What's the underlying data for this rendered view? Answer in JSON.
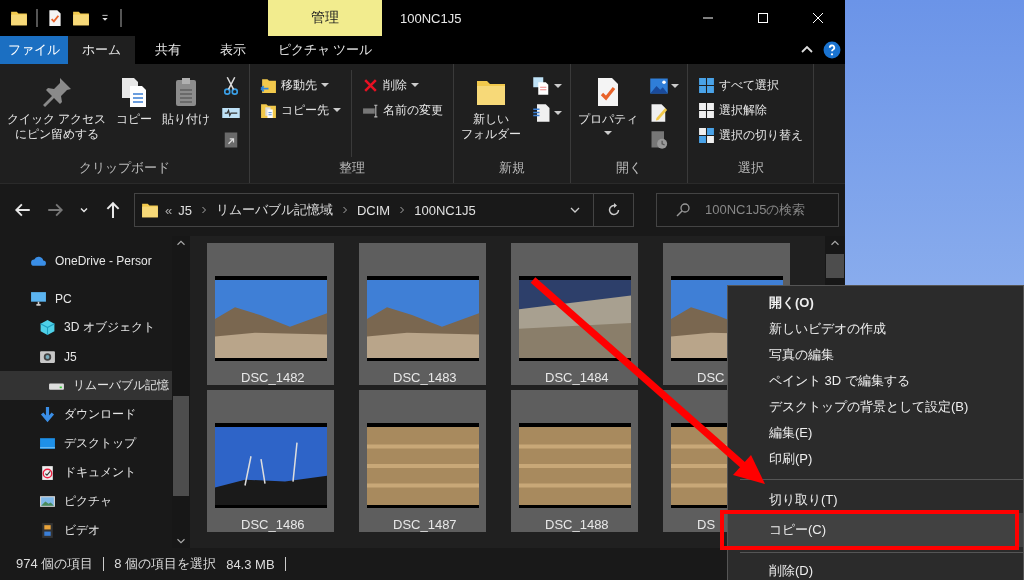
{
  "window": {
    "title": "100NC1J5",
    "context_tab": "管理"
  },
  "tabs": [
    {
      "label": "ファイル",
      "kind": "file",
      "selected": false
    },
    {
      "label": "ホーム",
      "kind": "tab",
      "selected": true
    },
    {
      "label": "共有",
      "kind": "tab",
      "selected": false
    },
    {
      "label": "表示",
      "kind": "tab",
      "selected": false
    },
    {
      "label": "ピクチャ ツール",
      "kind": "context",
      "selected": false
    }
  ],
  "ribbon": {
    "groups": [
      {
        "label": "クリップボード",
        "items": [
          {
            "kind": "large",
            "label": [
              "クイック アクセス",
              "にピン留めする"
            ]
          },
          {
            "kind": "large",
            "label": [
              "コピー"
            ]
          },
          {
            "kind": "large",
            "label": [
              "貼り付け"
            ]
          },
          {
            "kind": "stack",
            "items": [
              {
                "kind": "icon"
              },
              {
                "kind": "icon"
              },
              {
                "kind": "icon"
              }
            ]
          }
        ]
      },
      {
        "label": "整理",
        "items": [
          {
            "kind": "stack",
            "items": [
              {
                "kind": "button",
                "label": "移動先",
                "dropdown": true
              },
              {
                "kind": "button",
                "label": "コピー先",
                "dropdown": true
              }
            ]
          },
          {
            "kind": "stack",
            "items": [
              {
                "kind": "button",
                "label": "削除",
                "dropdown": true
              },
              {
                "kind": "button",
                "label": "名前の変更",
                "dropdown": false
              }
            ]
          }
        ]
      },
      {
        "label": "新規",
        "items": [
          {
            "kind": "large",
            "label": [
              "新しい",
              "フォルダー"
            ]
          },
          {
            "kind": "stack",
            "items": [
              {
                "kind": "icon",
                "dropdown": true
              },
              {
                "kind": "icon",
                "dropdown": true
              }
            ]
          }
        ]
      },
      {
        "label": "開く",
        "items": [
          {
            "kind": "large",
            "label": [
              "プロパティ"
            ],
            "dropdown": true
          },
          {
            "kind": "stack",
            "items": [
              {
                "kind": "icon",
                "dropdown": true
              },
              {
                "kind": "icon"
              },
              {
                "kind": "icon"
              }
            ]
          }
        ]
      },
      {
        "label": "選択",
        "items": [
          {
            "kind": "stack",
            "items": [
              {
                "kind": "button",
                "label": "すべて選択",
                "dropdown": false
              },
              {
                "kind": "button",
                "label": "選択解除",
                "dropdown": false
              },
              {
                "kind": "button",
                "label": "選択の切り替え",
                "dropdown": false
              }
            ]
          }
        ]
      }
    ]
  },
  "nav_buttons": [
    {
      "kind": "back",
      "disabled": false
    },
    {
      "kind": "forward",
      "disabled": true
    },
    {
      "kind": "recent",
      "disabled": false
    },
    {
      "kind": "up",
      "disabled": false
    }
  ],
  "address": {
    "overflow": "«",
    "path": [
      "J5",
      "リムーバブル記憶域",
      "DCIM",
      "100NC1J5"
    ]
  },
  "search": {
    "placeholder": "100NC1J5の検索"
  },
  "sidebar": {
    "items": [
      {
        "label": "OneDrive - Persor",
        "selected": false
      },
      {
        "label": "PC",
        "selected": false,
        "children": [
          {
            "label": "3D オブジェクト",
            "selected": false
          },
          {
            "label": "J5",
            "selected": false,
            "children": [
              {
                "label": "リムーバブル記憶",
                "selected": true
              }
            ]
          },
          {
            "label": "ダウンロード",
            "selected": false
          },
          {
            "label": "デスクトップ",
            "selected": false
          },
          {
            "label": "ドキュメント",
            "selected": false
          },
          {
            "label": "ピクチャ",
            "selected": false
          },
          {
            "label": "ビデオ",
            "selected": false
          }
        ]
      }
    ]
  },
  "files": [
    {
      "label": "DSC_1482",
      "selected": true
    },
    {
      "label": "DSC_1483",
      "selected": true
    },
    {
      "label": "DSC_1484",
      "selected": true
    },
    {
      "label": "DSC",
      "selected": true
    },
    {
      "label": "DSC_1486",
      "selected": true
    },
    {
      "label": "DSC_1487",
      "selected": true
    },
    {
      "label": "DSC_1488",
      "selected": true
    },
    {
      "label": "DS",
      "selected": true
    }
  ],
  "status_bar": {
    "count": "974 個の項目",
    "selection": "8 個の項目を選択",
    "size": "84.3 MB"
  },
  "context_menu": {
    "items": [
      {
        "kind": "item",
        "label": "開く(O)",
        "default": true,
        "selected": false
      },
      {
        "kind": "item",
        "label": "新しいビデオの作成",
        "selected": false
      },
      {
        "kind": "item",
        "label": "写真の編集",
        "selected": false
      },
      {
        "kind": "item",
        "label": "ペイント 3D で編集する",
        "selected": false
      },
      {
        "kind": "item",
        "label": "デスクトップの背景として設定(B)",
        "selected": false
      },
      {
        "kind": "item",
        "label": "編集(E)",
        "selected": false
      },
      {
        "kind": "item",
        "label": "印刷(P)",
        "selected": false
      },
      {
        "kind": "separator"
      },
      {
        "kind": "item",
        "label": "切り取り(T)",
        "selected": false
      },
      {
        "kind": "item",
        "label": "コピー(C)",
        "selected": true,
        "annotated": true
      },
      {
        "kind": "separator"
      },
      {
        "kind": "item",
        "label": "削除(D)",
        "selected": false
      }
    ]
  }
}
